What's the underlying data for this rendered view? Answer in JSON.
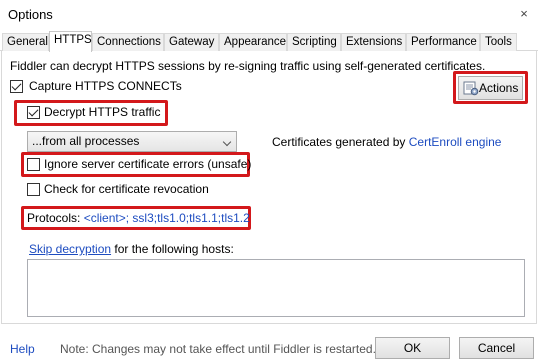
{
  "window": {
    "title": "Options",
    "close_glyph": "×"
  },
  "tabs": [
    {
      "label": "General"
    },
    {
      "label": "HTTPS",
      "active": true
    },
    {
      "label": "Connections"
    },
    {
      "label": "Gateway"
    },
    {
      "label": "Appearance"
    },
    {
      "label": "Scripting"
    },
    {
      "label": "Extensions"
    },
    {
      "label": "Performance"
    },
    {
      "label": "Tools"
    }
  ],
  "https": {
    "description": "Fiddler can decrypt HTTPS sessions by re-signing traffic using self-generated certificates.",
    "capture_label": "Capture HTTPS CONNECTs",
    "capture_checked": true,
    "actions_label": "Actions",
    "decrypt_label": "Decrypt HTTPS traffic",
    "decrypt_checked": true,
    "process_select_value": "...from all processes",
    "cert_text_prefix": "Certificates generated by ",
    "cert_engine": "CertEnroll engine",
    "ignore_errors_label": "Ignore server certificate errors (unsafe)",
    "ignore_errors_checked": false,
    "revocation_label": "Check for certificate revocation",
    "revocation_checked": false,
    "protocols_label": "Protocols: ",
    "protocols_value": "<client>; ssl3;tls1.0;tls1.1;tls1.2",
    "skip_link": "Skip decryption",
    "skip_rest": " for the following hosts:",
    "skip_hosts_value": ""
  },
  "footer": {
    "help_label": "Help",
    "note": "Note: Changes may not take effect until Fiddler is restarted.",
    "ok_label": "OK",
    "cancel_label": "Cancel"
  },
  "colors": {
    "highlight": "#d3181b",
    "link": "#1d4cc0"
  }
}
